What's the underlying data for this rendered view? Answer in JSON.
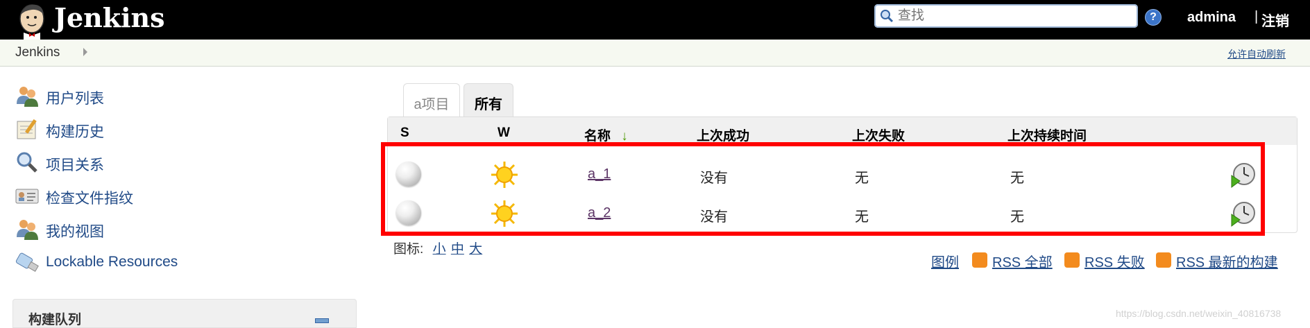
{
  "header": {
    "brand": "Jenkins",
    "search_placeholder": "查找",
    "help_glyph": "?",
    "user": "admina",
    "separator": "|",
    "logout": "注销"
  },
  "breadcrumb": {
    "home": "Jenkins",
    "auto_refresh": "允许自动刷新"
  },
  "sidebar": {
    "items": [
      {
        "label": "用户列表",
        "icon": "people-icon"
      },
      {
        "label": "构建历史",
        "icon": "notepad-icon"
      },
      {
        "label": "项目关系",
        "icon": "magnifier-icon"
      },
      {
        "label": "检查文件指纹",
        "icon": "fingerprint-card-icon"
      },
      {
        "label": "我的视图",
        "icon": "user-view-icon"
      },
      {
        "label": "Lockable Resources",
        "icon": "usb-drive-icon"
      }
    ],
    "queue_title": "构建队列"
  },
  "tabs": [
    {
      "label": "a项目",
      "active": false
    },
    {
      "label": "所有",
      "active": true
    }
  ],
  "table": {
    "headers": [
      "S",
      "W",
      "名称",
      "上次成功",
      "上次失败",
      "上次持续时间"
    ],
    "sort_indicator": "↓",
    "rows": [
      {
        "status": "grey-ball-icon",
        "weather": "sunny-icon",
        "name": "a_1",
        "last_success": "没有",
        "last_failure": "无",
        "last_duration": "无"
      },
      {
        "status": "grey-ball-icon",
        "weather": "sunny-icon",
        "name": "a_2",
        "last_success": "没有",
        "last_failure": "无",
        "last_duration": "无"
      }
    ]
  },
  "footer": {
    "icon_label": "图标:",
    "sizes": [
      "小",
      "中",
      "大"
    ],
    "legend": "图例",
    "rss_all": "RSS 全部",
    "rss_failed": "RSS 失败",
    "rss_latest": "RSS 最新的构建"
  },
  "watermark": "https://blog.csdn.net/weixin_40816738",
  "colors": {
    "header_bg": "#000000",
    "link": "#204a87",
    "highlight_box": "#ff0000",
    "rss": "#f38b1e"
  }
}
